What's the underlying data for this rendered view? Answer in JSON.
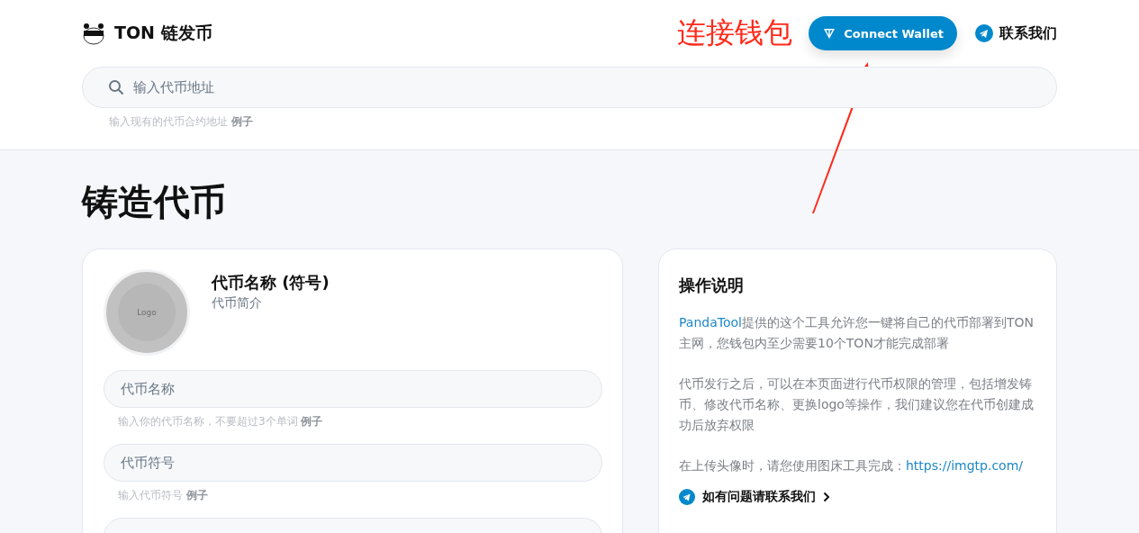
{
  "header": {
    "brand": "TON 链发币",
    "connect_button": "Connect Wallet",
    "contact_link": "联系我们"
  },
  "annotation": {
    "label": "连接钱包"
  },
  "search": {
    "placeholder": "输入代币地址",
    "hint": "输入现有的代币合约地址 **例子**"
  },
  "page_title": "铸造代币",
  "token_card": {
    "logo_label": "Logo",
    "name": "代币名称 (符号)",
    "description": "代币简介",
    "fields": [
      {
        "placeholder": "代币名称",
        "hint": "输入你的代币名称，不要超过3个单词 **例子**"
      },
      {
        "placeholder": "代币符号",
        "hint": "输入代币符号 **例子**"
      }
    ]
  },
  "help_card": {
    "title": "操作说明",
    "paragraphs": [
      [
        {
          "kind": "link",
          "text": "PandaTool"
        },
        {
          "kind": "text",
          "text": "提供的这个工具允许您一键将自己的代币部署到TON主网，您钱包内至少需要10个TON才能完成部署"
        }
      ],
      [
        {
          "kind": "text",
          "text": "代币发行之后，可以在本页面进行代币权限的管理，包括增发铸币、修改代币名称、更换logo等操作，我们建议您在代币创建成功后放弃权限"
        }
      ],
      [
        {
          "kind": "text",
          "text": "在上传头像时，请您使用图床工具完成："
        },
        {
          "kind": "link",
          "text": "https://imgtp.com/"
        }
      ]
    ],
    "contact_link": "如有问题请联系我们"
  }
}
